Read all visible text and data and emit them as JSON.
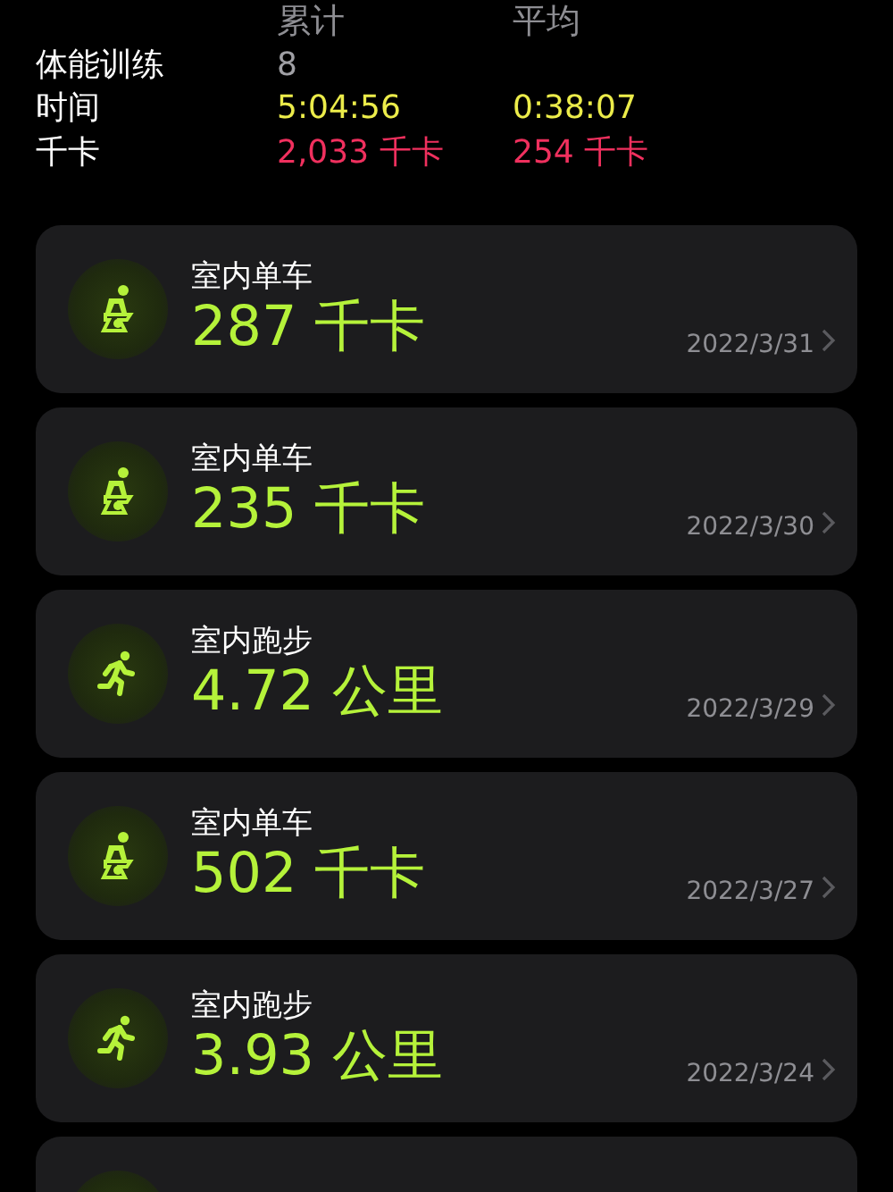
{
  "summary": {
    "columns": [
      "累计",
      "平均"
    ],
    "rows": [
      {
        "label": "体能训练",
        "kind": "count",
        "values": [
          "8"
        ]
      },
      {
        "label": "时间",
        "kind": "time",
        "values": [
          "5:04:56",
          "0:38:07"
        ]
      },
      {
        "label": "千卡",
        "kind": "energy",
        "values": [
          "2,033 千卡",
          "254 千卡"
        ]
      }
    ]
  },
  "workouts": [
    {
      "kind": "bike",
      "title": "室内单车",
      "value": "287 千卡",
      "date": "2022/3/31"
    },
    {
      "kind": "bike",
      "title": "室内单车",
      "value": "235 千卡",
      "date": "2022/3/30"
    },
    {
      "kind": "run",
      "title": "室内跑步",
      "value": "4.72 公里",
      "date": "2022/3/29"
    },
    {
      "kind": "bike",
      "title": "室内单车",
      "value": "502 千卡",
      "date": "2022/3/27"
    },
    {
      "kind": "run",
      "title": "室内跑步",
      "value": "3.93 公里",
      "date": "2022/3/24"
    },
    {
      "kind": "partial"
    }
  ]
}
